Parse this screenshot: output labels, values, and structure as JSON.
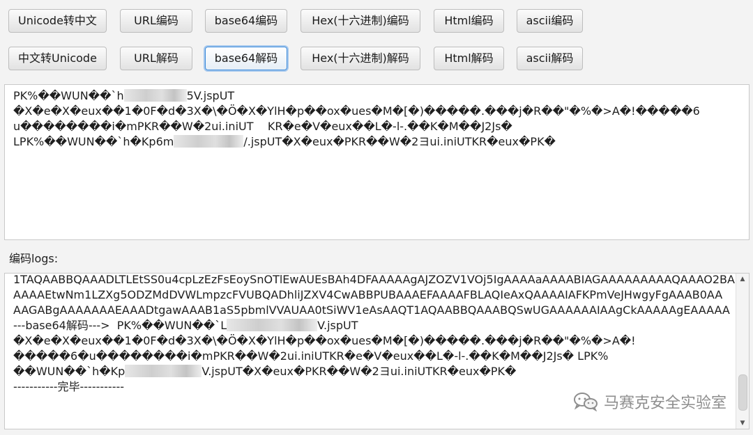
{
  "buttons_row1": [
    {
      "label": "Unicode转中文"
    },
    {
      "label": "URL编码"
    },
    {
      "label": "base64编码"
    },
    {
      "label": "Hex(十六进制)编码"
    },
    {
      "label": "Html编码"
    },
    {
      "label": "ascii编码"
    }
  ],
  "buttons_row2": [
    {
      "label": "中文转Unicode"
    },
    {
      "label": "URL解码"
    },
    {
      "label": "base64解码"
    },
    {
      "label": "Hex(十六进制)解码"
    },
    {
      "label": "Html解码"
    },
    {
      "label": "ascii解码"
    }
  ],
  "output": {
    "line1_a": "PK%��WUN��`h",
    "line1_b": "5V.jspUT",
    "line2": "�X�e�X�eux��1�0F�d�3X�\\�Ö�X�YlH�p��ox�ues�M�[�)�����.���j�R��\"�%�>A�!�����6",
    "line3": "u��������i�mPKR��W�2ui.iniUT    KR�e�V�eux��L�-l-.��K�M��J2Js�",
    "line4_a": "LPK%��WUN��`h�Kp6m",
    "line4_b": "/.jspUT�X�eux�PKR��W�2ヨui.iniUTKR�eux�PK�"
  },
  "logs": {
    "label": "编码logs:",
    "line1": "1TAQAABBQAAADLTLEtSS0u4cpLzEzFsEoySnOTlEwAUEsBAh4DFAAAAAgAJZOZV1VOj5IgAAAAaAAAABIAGAAAAAAAAAQAAAO2BA",
    "line2": "AAAAEtwNm1LZXg5ODZMdDVWLmpzcFVUBQADhliJZXV4CwABBPUBAAAEFAAAAFBLAQIeAxQAAAAIAFKPmVeJHwgyFgAAAB0AA",
    "line3": "AAGABgAAAAAAAEAAADtgawAAAB1aS5pbmlVVAUAA0tSiWV1eAsAAQT1AQAABBQAAABQSwUGAAAAAAIAAgCkAAAAAgEAAAAA",
    "line4_a": "---base64解码--->  PK%��WUN��`L",
    "line4_b": "V.jspUT",
    "line5": "�X�e�X�eux��1�0F�d�3X�\\�Ö�X�YlH�p��ox�ues�M�[�)�����.���j�R��\"�%�>A�!",
    "line6": "�����6�u��������i�mPKR��W�2ui.iniUTKR�e�V�eux��L�-l-.��K�M��J2Js� LPK%",
    "line7_a": "��WUN��`h�Kp",
    "line7_b": "V.jspUT�X�eux�PKR��W�2ヨui.iniUTKR�eux�PK�",
    "line8": "-----------完毕-----------"
  },
  "watermark": {
    "text": "马赛克安全实验室",
    "icon": "wechat-icon"
  }
}
